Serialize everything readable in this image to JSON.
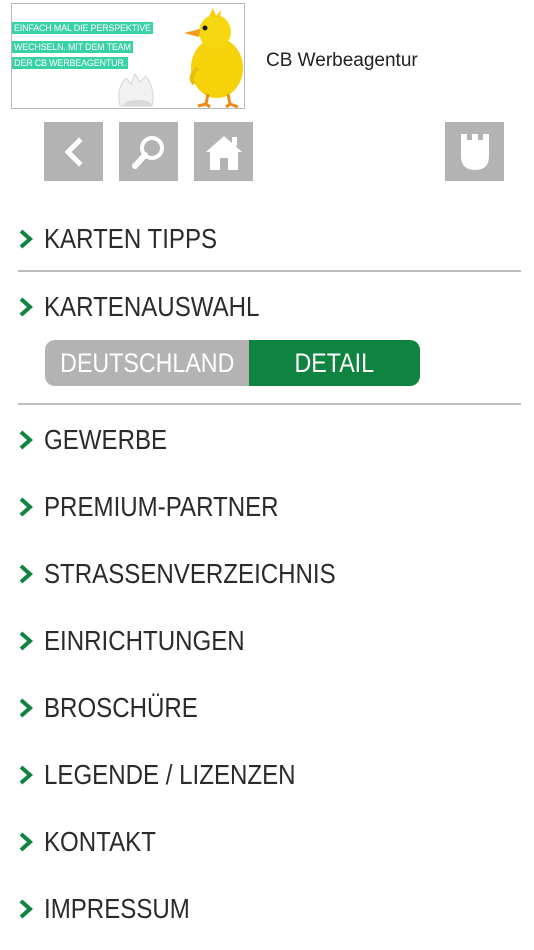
{
  "header": {
    "ad_lines": [
      "EINFACH MAL DIE PERSPEKTIVE",
      "WECHSELN. MIT DEM TEAM",
      "DER CB WERBEAGENTUR."
    ],
    "brand_name": "CB Werbeagentur"
  },
  "toolbar": {
    "icons": [
      "chevron-left-icon",
      "search-icon",
      "home-icon",
      "pocket-icon"
    ],
    "button_color": "#b3b3b3"
  },
  "menu": {
    "items": [
      {
        "label": "KARTEN TIPPS"
      },
      {
        "label": "KARTENAUSWAHL"
      },
      {
        "label": "GEWERBE"
      },
      {
        "label": "PREMIUM-PARTNER"
      },
      {
        "label": "STRASSENVERZEICHNIS"
      },
      {
        "label": "EINRICHTUNGEN"
      },
      {
        "label": "BROSCHÜRE"
      },
      {
        "label": "LEGENDE / LIZENZEN"
      },
      {
        "label": "KONTAKT"
      },
      {
        "label": "IMPRESSUM"
      }
    ],
    "chevron_color": "#0f8440"
  },
  "map_toggle": {
    "options": [
      "DEUTSCHLAND",
      "DETAIL"
    ],
    "selected": "DETAIL",
    "active_color": "#0f8440",
    "inactive_color": "#b3b3b3"
  }
}
